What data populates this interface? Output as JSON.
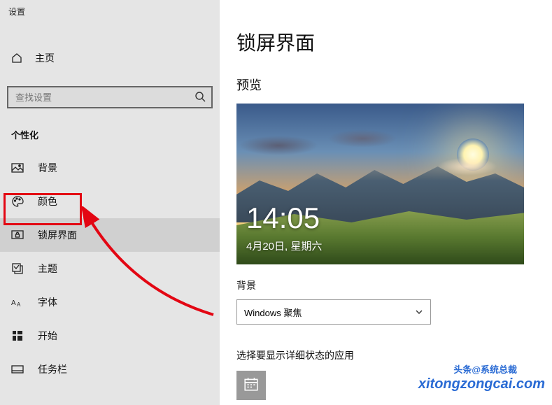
{
  "app_title": "设置",
  "home_label": "主页",
  "search": {
    "placeholder": "查找设置"
  },
  "section": "个性化",
  "nav": {
    "background": "背景",
    "colors": "颜色",
    "lockscreen": "锁屏界面",
    "themes": "主题",
    "fonts": "字体",
    "start": "开始",
    "taskbar": "任务栏"
  },
  "page_title": "锁屏界面",
  "preview_label": "预览",
  "preview": {
    "time": "14:05",
    "date": "4月20日, 星期六"
  },
  "bg_label": "背景",
  "bg_dropdown": "Windows 聚焦",
  "detail_label": "选择要显示详细状态的应用",
  "watermark_main": "xitongzongcai.com",
  "watermark_sub": "头条@系统总裁"
}
